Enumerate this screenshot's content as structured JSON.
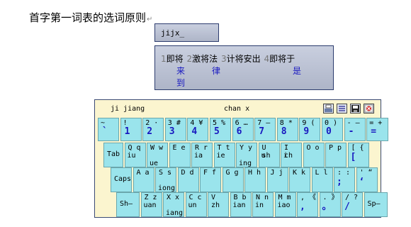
{
  "document": {
    "heading": "首字第一词表的选词原则"
  },
  "composition": {
    "text": "jijx_"
  },
  "candidates": {
    "items": [
      {
        "num": "1",
        "text": "即将"
      },
      {
        "num": "2",
        "text": "激将法"
      },
      {
        "num": "3",
        "text": "计将安出"
      },
      {
        "num": "4",
        "text": "即将于"
      }
    ],
    "continuations": [
      "来",
      "律",
      "是",
      "到"
    ]
  },
  "keyboard": {
    "pinyin_display": "ji jiang",
    "mode_display": "chan x",
    "toolbar_icons": [
      "keyboard-icon",
      "list-icon",
      "save-icon",
      "close-icon"
    ],
    "row1": [
      {
        "upper": "~",
        "lower": "`"
      },
      {
        "upper": "!",
        "lower": "1",
        "mark": "!"
      },
      {
        "upper": "2",
        "mark": "·",
        "lower": "2"
      },
      {
        "upper": "3",
        "mark": "#",
        "lower": "3"
      },
      {
        "upper": "4",
        "mark": "¥",
        "lower": "4"
      },
      {
        "upper": "5",
        "mark": "%",
        "lower": "5"
      },
      {
        "upper": "6",
        "mark": "…",
        "lower": "6"
      },
      {
        "upper": "7",
        "mark": "—",
        "lower": "7"
      },
      {
        "upper": "8",
        "mark": "*",
        "lower": "8"
      },
      {
        "upper": "9",
        "mark": "(",
        "lower": "9"
      },
      {
        "upper": "0",
        "mark": ")",
        "lower": "0"
      },
      {
        "upper": "-",
        "mark": "—",
        "lower": "-"
      },
      {
        "upper": "=",
        "mark": "+",
        "lower": "="
      }
    ],
    "row2": [
      {
        "label": "Tab"
      },
      {
        "upper": "Q",
        "ch": "q",
        "py": "iu"
      },
      {
        "upper": "W",
        "ch": "w",
        "py2": "ue"
      },
      {
        "upper": "E",
        "ch": "e"
      },
      {
        "upper": "R",
        "ch": "r",
        "py": "ia"
      },
      {
        "upper": "T",
        "ch": "t",
        "py": "ie"
      },
      {
        "upper": "Y",
        "ch": "y",
        "py2": "ing"
      },
      {
        "upper": "U",
        "ch": "sh",
        "py": "u"
      },
      {
        "upper": "I",
        "ch": "ch",
        "py": "i"
      },
      {
        "upper": "O",
        "ch": "o"
      },
      {
        "upper": "P",
        "ch": "p"
      },
      {
        "upper": "[",
        "ch": "{",
        "plow": "["
      }
    ],
    "row3": [
      {
        "label": "Caps"
      },
      {
        "upper": "A",
        "ch": "a"
      },
      {
        "upper": "S",
        "ch": "s",
        "py2": "iong"
      },
      {
        "upper": "D",
        "ch": "d"
      },
      {
        "upper": "F",
        "ch": "f"
      },
      {
        "upper": "G",
        "ch": "g"
      },
      {
        "upper": "H",
        "ch": "h"
      },
      {
        "upper": "J",
        "ch": "j"
      },
      {
        "upper": "K",
        "ch": "k"
      },
      {
        "upper": "L",
        "ch": "l"
      },
      {
        "upper": ":",
        "ch": ":",
        "plow": ";"
      },
      {
        "upper": "'",
        "ch": "“",
        "plow": "‘"
      }
    ],
    "row4": [
      {
        "label": "Sh—"
      },
      {
        "upper": "Z",
        "ch": "z",
        "py": "uan"
      },
      {
        "upper": "X",
        "ch": "x",
        "py2": "iang"
      },
      {
        "upper": "C",
        "ch": "c",
        "py": "un"
      },
      {
        "upper": "V",
        "ch": "zh"
      },
      {
        "upper": "B",
        "ch": "b",
        "py": "ian"
      },
      {
        "upper": "N",
        "ch": "n",
        "py": "in"
      },
      {
        "upper": "M",
        "ch": "m",
        "py": "iao"
      },
      {
        "upper": ",",
        "ch": "《",
        "plow": ","
      },
      {
        "upper": ".",
        "ch": "》",
        "plow": "。"
      },
      {
        "upper": "/",
        "ch": "?",
        "plow": "/"
      },
      {
        "label": "Sp—"
      }
    ]
  }
}
